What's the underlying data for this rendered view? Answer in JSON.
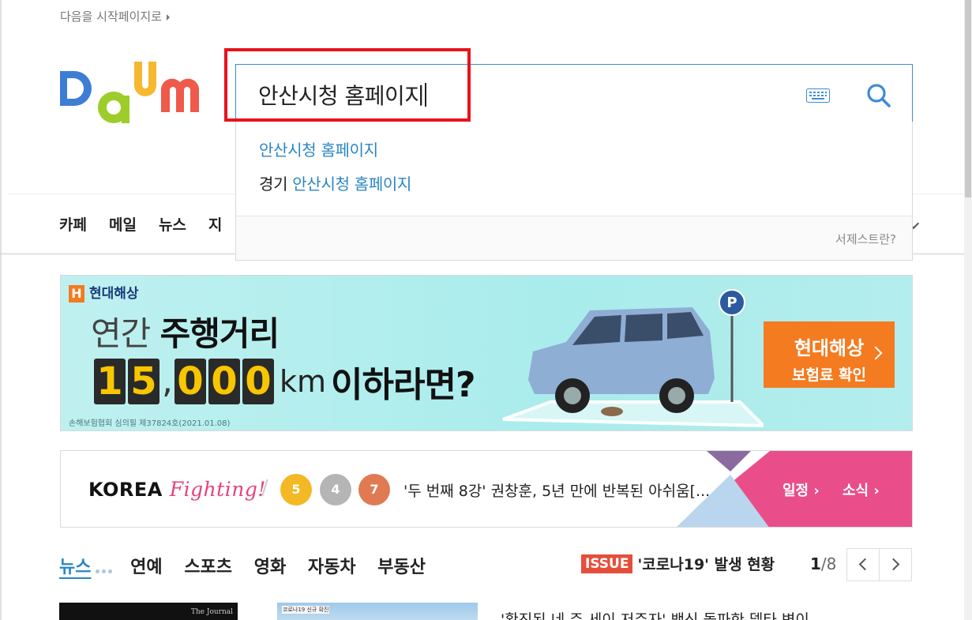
{
  "header": {
    "set_start_label": "다음을 시작페이지로",
    "logo_alt": "Daum"
  },
  "search": {
    "query": "안산시청 홈페이지",
    "suggestions": [
      {
        "prefix": "",
        "match": "안산시청 홈페이지"
      },
      {
        "prefix": "경기 ",
        "match": "안산시청 홈페이지"
      }
    ],
    "help_link": "서제스트란?"
  },
  "gnb": {
    "items": [
      "카페",
      "메일",
      "뉴스",
      "지"
    ]
  },
  "ad": {
    "brand": "현대해상",
    "brand_mark": "H",
    "line1_light": "연간 ",
    "line1_bold": "주행거리",
    "digits": [
      "1",
      "5",
      "0",
      "0",
      "0"
    ],
    "comma": ",",
    "unit": "km",
    "tail": "이하라면?",
    "fine_print": "손해보험협회 심의필 제37824호(2021.01.08)",
    "cta_line1": "현대해상",
    "cta_line2": "보험료 확인",
    "parking_sign": "P"
  },
  "olympics": {
    "title_bold": "KOREA",
    "title_script": "Fighting!",
    "medals": [
      {
        "count": "5",
        "color": "#f3b824"
      },
      {
        "count": "4",
        "color": "#b5b5b5"
      },
      {
        "count": "7",
        "color": "#e07a52"
      }
    ],
    "headline": "'두 번째 8강' 권창훈, 5년 만에 반복된 아쉬움[...",
    "link_schedule": "일정",
    "link_news": "소식"
  },
  "content_tabs": {
    "items": [
      "뉴스",
      "연예",
      "스포츠",
      "영화",
      "자동차",
      "부동산"
    ],
    "active_index": 0
  },
  "issue": {
    "badge": "ISSUE",
    "text": "'코로나19' 발생 현황",
    "page_current": "1",
    "page_total": "/8"
  },
  "news_preview": {
    "thumb1_text": "The Journal",
    "thumb2_text": "코로나19 신규 확진",
    "headline": "'확진된 네 주 세이 저주자' 백신 돌파한 델타 변이"
  },
  "colors": {
    "accent": "#2a86c4",
    "highlight_border": "#e8121b",
    "search_border": "#3f8bd6",
    "ad_cta": "#f47b20",
    "issue_badge": "#e44f3c"
  }
}
